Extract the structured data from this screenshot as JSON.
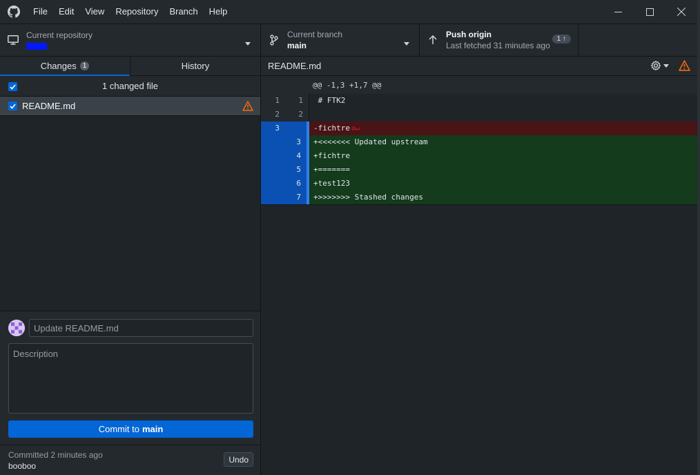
{
  "menu": [
    "File",
    "Edit",
    "View",
    "Repository",
    "Branch",
    "Help"
  ],
  "toolbar": {
    "repo_label": "Current repository",
    "branch_label": "Current branch",
    "branch_value": "main",
    "push_label": "Push origin",
    "push_sub": "Last fetched 31 minutes ago",
    "push_badge": "1 ↑"
  },
  "tabs": {
    "changes": "Changes",
    "changes_count": "1",
    "history": "History"
  },
  "changes": {
    "header": "1 changed file",
    "files": [
      {
        "name": "README.md"
      }
    ]
  },
  "commit": {
    "summary_placeholder": "Update README.md",
    "description_placeholder": "Description",
    "button_prefix": "Commit to",
    "button_branch": "main"
  },
  "last_commit": {
    "label": "Committed 2 minutes ago",
    "message": "booboo",
    "undo": "Undo"
  },
  "diff": {
    "file": "README.md",
    "hunk": "@@ -1,3 +1,7 @@",
    "lines": [
      {
        "old": "1",
        "new": "1",
        "text": " # FTK2",
        "kind": "ctx"
      },
      {
        "old": "2",
        "new": "2",
        "text": "",
        "kind": "ctx"
      },
      {
        "old": "3",
        "new": "",
        "text": "-fichtre",
        "kind": "del"
      },
      {
        "old": "",
        "new": "3",
        "text": "+<<<<<<< Updated upstream",
        "kind": "add"
      },
      {
        "old": "",
        "new": "4",
        "text": "+fichtre",
        "kind": "add"
      },
      {
        "old": "",
        "new": "5",
        "text": "+=======",
        "kind": "add"
      },
      {
        "old": "",
        "new": "6",
        "text": "+test123",
        "kind": "add"
      },
      {
        "old": "",
        "new": "7",
        "text": "+>>>>>>> Stashed changes",
        "kind": "add"
      }
    ]
  },
  "colors": {
    "accent": "#0366d6",
    "warning": "#f66a0a",
    "deleted": "#4a1316",
    "added": "#133b1c"
  }
}
